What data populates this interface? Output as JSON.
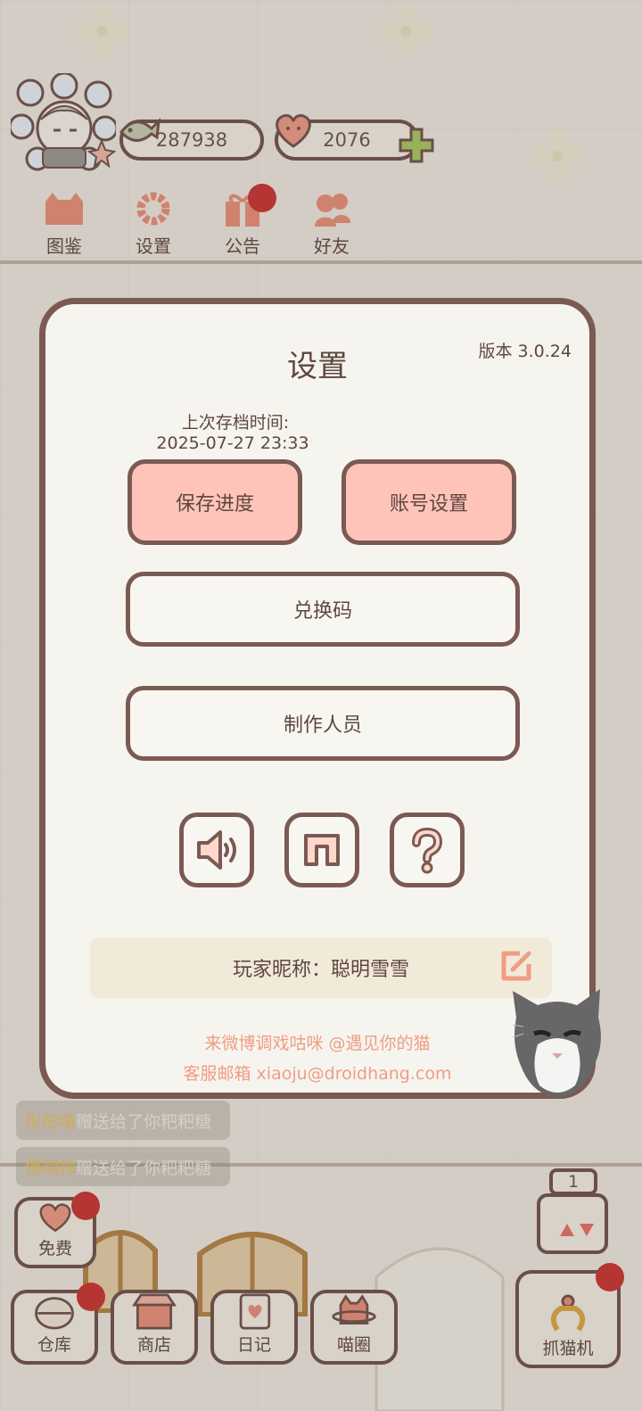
{
  "header": {
    "coins": "287938",
    "hearts": "2076"
  },
  "top_nav": [
    {
      "label": "图鉴"
    },
    {
      "label": "设置"
    },
    {
      "label": "公告"
    },
    {
      "label": "好友"
    }
  ],
  "chat": [
    {
      "sender": "彤彤嘻",
      "message": "赠送给了你粑粑糖"
    },
    {
      "sender": "傅明帅",
      "message": "赠送给了你粑粑糖"
    }
  ],
  "bottom_bar": {
    "free": "免费",
    "warehouse": "仓库",
    "shop": "商店",
    "diary": "日记",
    "circle": "喵圈",
    "claw": "抓猫机",
    "counter": "1"
  },
  "settings": {
    "title": "设置",
    "version": "版本 3.0.24",
    "save_time_label": "上次存档时间:",
    "save_time_value": "2025-07-27 23:33",
    "save_button": "保存进度",
    "account_button": "账号设置",
    "redeem_button": "兑换码",
    "credits_button": "制作人员",
    "nickname_label": "玩家昵称：",
    "nickname_value": "聪明雪雪",
    "weibo_text": "来微博调戏咕咪 @遇见你的猫",
    "email_text": "客服邮箱 xiaoju@droidhang.com"
  },
  "colors": {
    "accent_pink": "#ffc4b9",
    "border_brown": "#7a5a52",
    "panel_bg": "#f6f4ee",
    "link_salmon": "#ef9d84",
    "notification_red": "#c9302c"
  },
  "icons": [
    "speaker-icon",
    "music-note-icon",
    "question-icon",
    "edit-icon",
    "fish-coin-icon",
    "heart-icon",
    "plus-icon",
    "cat-book-icon",
    "gear-icon",
    "gift-icon",
    "friends-icon"
  ]
}
